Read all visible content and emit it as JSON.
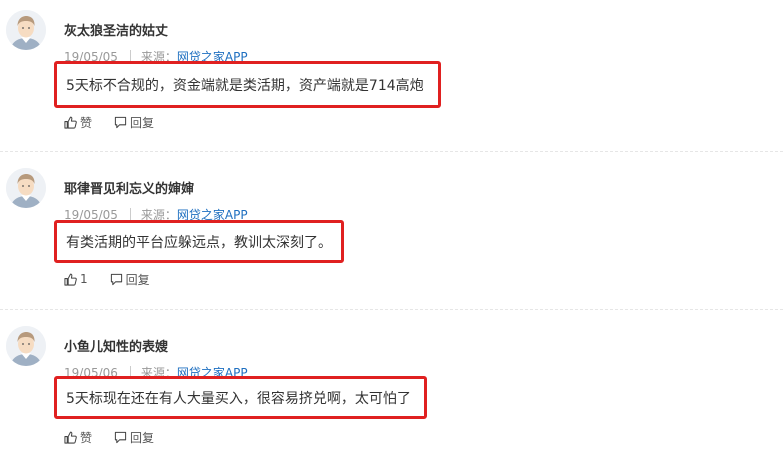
{
  "comments": [
    {
      "username": "灰太狼圣洁的姑丈",
      "date": "19/05/05",
      "source_label": "来源：",
      "source_link": "网贷之家APP",
      "content": "5天标不合规的，资金端就是类活期，资产端就是714高炮",
      "like_label": "赞",
      "reply_label": "回复"
    },
    {
      "username": "耶律晋见利忘义的婶婶",
      "date": "19/05/05",
      "source_label": "来源：",
      "source_link": "网贷之家APP",
      "content": "有类活期的平台应躲远点，教训太深刻了。",
      "like_label": "1",
      "reply_label": "回复"
    },
    {
      "username": "小鱼儿知性的表嫂",
      "date": "19/05/06",
      "source_label": "来源：",
      "source_link": "网贷之家APP",
      "content": "5天标现在还在有人大量买入，很容易挤兑啊，太可怕了",
      "like_label": "赞",
      "reply_label": "回复"
    }
  ],
  "colors": {
    "highlight_border": "#e02020",
    "link": "#1e6fc0",
    "meta": "#999999"
  },
  "icons": {
    "like": "thumbs-up-icon",
    "reply": "speech-bubble-icon",
    "avatar": "user-avatar-icon"
  }
}
